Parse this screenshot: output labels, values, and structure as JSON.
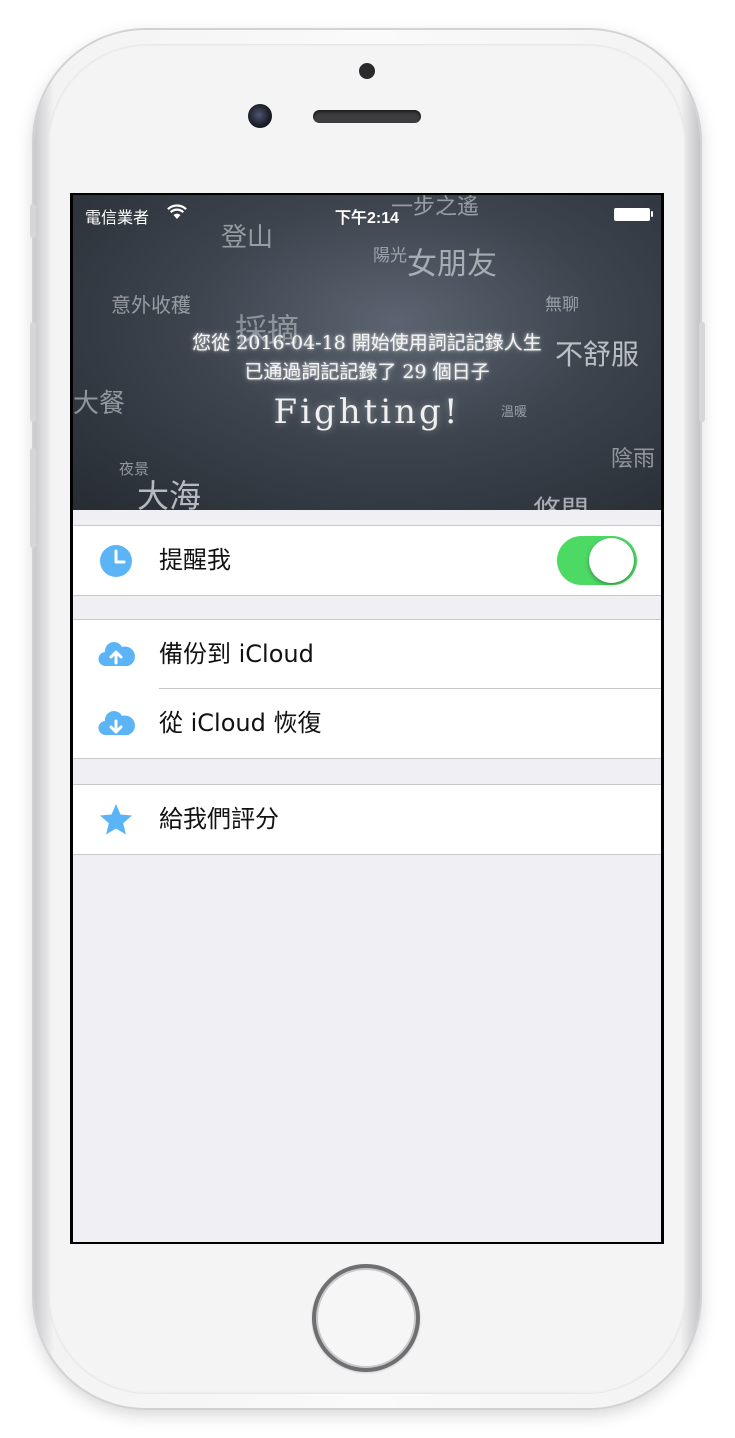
{
  "status_bar": {
    "carrier": "電信業者",
    "time": "下午2:14"
  },
  "header": {
    "words": [
      "一步之遙",
      "登山",
      "陽光",
      "女朋友",
      "意外收穫",
      "無聊",
      "採摘",
      "不舒服",
      "大餐",
      "溫暖",
      "陰雨",
      "夜景",
      "大海",
      "悠閒"
    ],
    "line1": "您從 2016-04-18 開始使用詞記記錄人生",
    "line2": "已通過詞記記錄了 29 個日子",
    "motto": "Fighting!"
  },
  "settings": {
    "remind": {
      "label": "提醒我",
      "icon": "clock-icon",
      "enabled": true
    },
    "backup": {
      "label": "備份到 iCloud",
      "icon": "cloud-upload-icon"
    },
    "restore": {
      "label": "從 iCloud 恢復",
      "icon": "cloud-download-icon"
    },
    "rate": {
      "label": "給我們評分",
      "icon": "star-icon"
    }
  },
  "colors": {
    "accent": "#5ab4f5",
    "toggle_on": "#4cd964",
    "background": "#efeff4"
  }
}
